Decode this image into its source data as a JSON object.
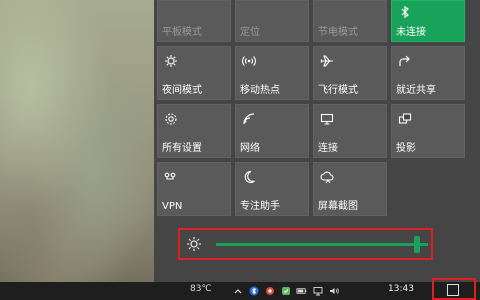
{
  "tiles": [
    {
      "label": "平板模式",
      "icon": "tablet-mode-icon",
      "state": "dim"
    },
    {
      "label": "定位",
      "icon": "location-icon",
      "state": "dim"
    },
    {
      "label": "节电模式",
      "icon": "battery-saver-icon",
      "state": "dim"
    },
    {
      "label": "未连接",
      "icon": "bluetooth-icon",
      "state": "on"
    },
    {
      "label": "夜间模式",
      "icon": "night-light-icon",
      "state": "off"
    },
    {
      "label": "移动热点",
      "icon": "mobile-hotspot-icon",
      "state": "off"
    },
    {
      "label": "飞行模式",
      "icon": "airplane-icon",
      "state": "off"
    },
    {
      "label": "就近共享",
      "icon": "nearby-share-icon",
      "state": "off"
    },
    {
      "label": "所有设置",
      "icon": "settings-gear-icon",
      "state": "off"
    },
    {
      "label": "网络",
      "icon": "network-icon",
      "state": "off"
    },
    {
      "label": "连接",
      "icon": "connect-icon",
      "state": "off"
    },
    {
      "label": "投影",
      "icon": "project-icon",
      "state": "off"
    },
    {
      "label": "VPN",
      "icon": "vpn-icon",
      "state": "off"
    },
    {
      "label": "专注助手",
      "icon": "focus-assist-icon",
      "state": "off"
    },
    {
      "label": "屏幕截图",
      "icon": "screen-snip-icon",
      "state": "off"
    }
  ],
  "brightness": {
    "icon": "brightness-sun-icon",
    "level_percent": 95
  },
  "taskbar": {
    "temperature": "83℃",
    "tray_icons": [
      "chevron-up-icon",
      "bluetooth-tray-icon",
      "app-tray-icon",
      "app-tray-icon-2",
      "battery-tray-icon",
      "monitor-tray-icon",
      "volume-icon"
    ],
    "time": "13:43"
  },
  "colors": {
    "accent": "#19a35a",
    "highlight_border": "#e02020",
    "tile_bg": "#5a5a5a",
    "panel_bg": "#454545"
  }
}
